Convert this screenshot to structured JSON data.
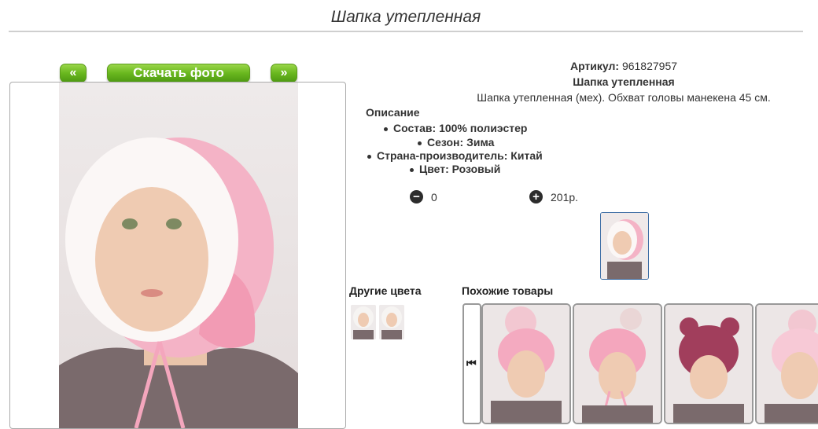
{
  "page": {
    "title": "Шапка утепленная"
  },
  "gallery": {
    "prev_label": "«",
    "download_label": "Скачать фото",
    "next_label": "»"
  },
  "product": {
    "article_label": "Артикул:",
    "article_value": "961827957",
    "name": "Шапка утепленная",
    "description": "Шапка утепленная (мех). Обхват головы манекена 45 см.",
    "description_heading": "Описание",
    "properties": [
      "Состав: 100% полиэстер",
      "Сезон: Зима",
      "Страна-производитель: Китай",
      "Цвет: Розовый"
    ]
  },
  "order": {
    "minus_icon": "−",
    "quantity": "0",
    "plus_icon": "+",
    "price": "201р."
  },
  "other_colors": {
    "heading": "Другие цвета"
  },
  "similar": {
    "heading": "Похожие товары",
    "left_arrow": "⏮"
  },
  "colors": {
    "brand_green": "#6ab81f",
    "hat_pink": "#f4b3c6",
    "fur_white": "#fbf7f6",
    "thumb_border": "#3f6ea5"
  }
}
